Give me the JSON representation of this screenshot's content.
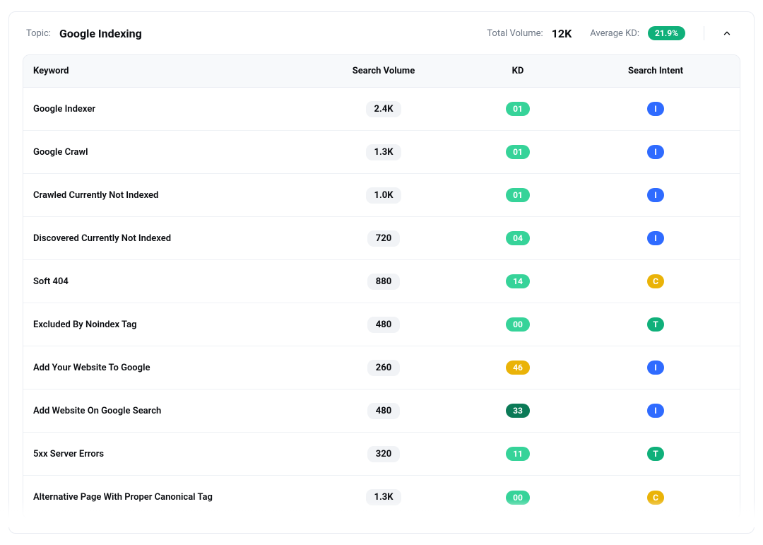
{
  "header": {
    "topic_label": "Topic:",
    "topic_value": "Google Indexing",
    "total_volume_label": "Total Volume:",
    "total_volume_value": "12K",
    "average_kd_label": "Average KD:",
    "average_kd_value": "21.9%"
  },
  "table": {
    "columns": {
      "keyword": "Keyword",
      "search_volume": "Search Volume",
      "kd": "KD",
      "search_intent": "Search Intent"
    },
    "rows": [
      {
        "keyword": "Google Indexer",
        "volume": "2.4K",
        "kd": "01",
        "kd_class": "kd-light",
        "intent": "I",
        "intent_class": "intent-i"
      },
      {
        "keyword": "Google Crawl",
        "volume": "1.3K",
        "kd": "01",
        "kd_class": "kd-light",
        "intent": "I",
        "intent_class": "intent-i"
      },
      {
        "keyword": "Crawled Currently Not Indexed",
        "volume": "1.0K",
        "kd": "01",
        "kd_class": "kd-light",
        "intent": "I",
        "intent_class": "intent-i"
      },
      {
        "keyword": "Discovered Currently Not Indexed",
        "volume": "720",
        "kd": "04",
        "kd_class": "kd-light",
        "intent": "I",
        "intent_class": "intent-i"
      },
      {
        "keyword": "Soft 404",
        "volume": "880",
        "kd": "14",
        "kd_class": "kd-light",
        "intent": "C",
        "intent_class": "intent-c"
      },
      {
        "keyword": "Excluded By Noindex Tag",
        "volume": "480",
        "kd": "00",
        "kd_class": "kd-light",
        "intent": "T",
        "intent_class": "intent-t"
      },
      {
        "keyword": "Add Your Website To Google",
        "volume": "260",
        "kd": "46",
        "kd_class": "kd-amber",
        "intent": "I",
        "intent_class": "intent-i"
      },
      {
        "keyword": "Add Website On Google Search",
        "volume": "480",
        "kd": "33",
        "kd_class": "kd-dark",
        "intent": "I",
        "intent_class": "intent-i"
      },
      {
        "keyword": "5xx Server Errors",
        "volume": "320",
        "kd": "11",
        "kd_class": "kd-light",
        "intent": "T",
        "intent_class": "intent-t"
      },
      {
        "keyword": "Alternative Page With Proper Canonical Tag",
        "volume": "1.3K",
        "kd": "00",
        "kd_class": "kd-light",
        "intent": "C",
        "intent_class": "intent-c"
      }
    ]
  }
}
